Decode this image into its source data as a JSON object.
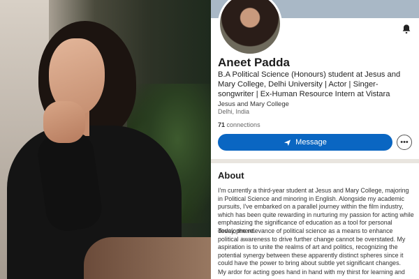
{
  "profile": {
    "name": "Aneet Padda",
    "headline": "B.A Political Science (Honours) student at Jesus and Mary College, Delhi University | Actor | Singer-songwriter | Ex-Human Resource Intern at Vistara",
    "education": "Jesus and Mary College",
    "location": "Delhi, India",
    "connections_count": "71",
    "connections_label": "connections"
  },
  "actions": {
    "message_label": "Message",
    "more_label": "•••"
  },
  "icons": {
    "bell": "bell-icon",
    "send": "send-icon",
    "more": "more-icon"
  },
  "about": {
    "title": "About",
    "paragraphs": [
      "I'm currently a third-year student at Jesus and Mary College, majoring in Political Science and minoring in English. Alongside my academic pursuits, I've embarked on a parallel journey within the film industry, which has been quite rewarding in nurturing my passion for acting while emphasizing the significance of education as a tool for personal development.",
      "Today, the relevance of political science as a means to enhance political awareness to drive further change cannot be overstated. My aspiration is to unite the realms of art and politics, recognizing the potential synergy between these apparently distinct spheres since it could have the power to bring about subtle yet significant changes.",
      "My ardor for acting goes hand in hand with my thirst for learning and my"
    ]
  },
  "colors": {
    "primary_button": "#0a66c2",
    "divider": "#e9e5df"
  }
}
